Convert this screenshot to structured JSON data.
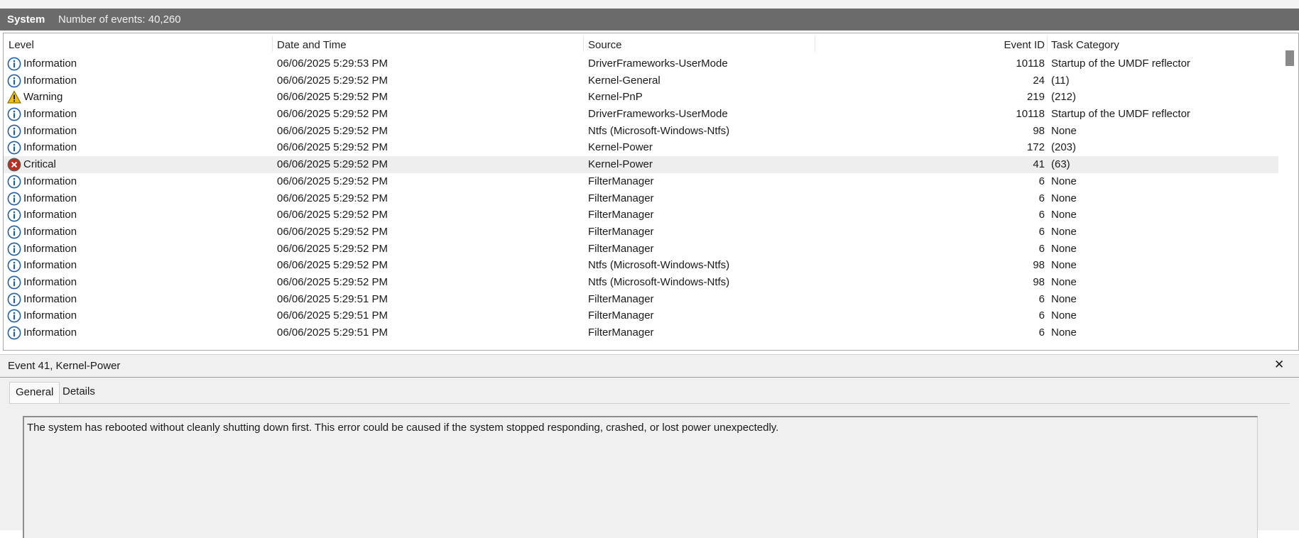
{
  "header": {
    "log_name": "System",
    "event_count": "Number of events: 40,260"
  },
  "columns": {
    "level": "Level",
    "date": "Date and Time",
    "source": "Source",
    "event_id": "Event ID",
    "task": "Task Category"
  },
  "rows": [
    {
      "level": "Information",
      "icon": "info-icon",
      "date": "06/06/2025 5:29:53 PM",
      "source": "DriverFrameworks-UserMode",
      "id": "10118",
      "task": "Startup of the UMDF reflector"
    },
    {
      "level": "Information",
      "icon": "info-icon",
      "date": "06/06/2025 5:29:52 PM",
      "source": "Kernel-General",
      "id": "24",
      "task": "(11)"
    },
    {
      "level": "Warning",
      "icon": "warning-icon",
      "date": "06/06/2025 5:29:52 PM",
      "source": "Kernel-PnP",
      "id": "219",
      "task": "(212)"
    },
    {
      "level": "Information",
      "icon": "info-icon",
      "date": "06/06/2025 5:29:52 PM",
      "source": "DriverFrameworks-UserMode",
      "id": "10118",
      "task": "Startup of the UMDF reflector"
    },
    {
      "level": "Information",
      "icon": "info-icon",
      "date": "06/06/2025 5:29:52 PM",
      "source": "Ntfs (Microsoft-Windows-Ntfs)",
      "id": "98",
      "task": "None"
    },
    {
      "level": "Information",
      "icon": "info-icon",
      "date": "06/06/2025 5:29:52 PM",
      "source": "Kernel-Power",
      "id": "172",
      "task": "(203)"
    },
    {
      "level": "Critical",
      "icon": "critical-icon",
      "date": "06/06/2025 5:29:52 PM",
      "source": "Kernel-Power",
      "id": "41",
      "task": "(63)",
      "selected": true
    },
    {
      "level": "Information",
      "icon": "info-icon",
      "date": "06/06/2025 5:29:52 PM",
      "source": "FilterManager",
      "id": "6",
      "task": "None"
    },
    {
      "level": "Information",
      "icon": "info-icon",
      "date": "06/06/2025 5:29:52 PM",
      "source": "FilterManager",
      "id": "6",
      "task": "None"
    },
    {
      "level": "Information",
      "icon": "info-icon",
      "date": "06/06/2025 5:29:52 PM",
      "source": "FilterManager",
      "id": "6",
      "task": "None"
    },
    {
      "level": "Information",
      "icon": "info-icon",
      "date": "06/06/2025 5:29:52 PM",
      "source": "FilterManager",
      "id": "6",
      "task": "None"
    },
    {
      "level": "Information",
      "icon": "info-icon",
      "date": "06/06/2025 5:29:52 PM",
      "source": "FilterManager",
      "id": "6",
      "task": "None"
    },
    {
      "level": "Information",
      "icon": "info-icon",
      "date": "06/06/2025 5:29:52 PM",
      "source": "Ntfs (Microsoft-Windows-Ntfs)",
      "id": "98",
      "task": "None"
    },
    {
      "level": "Information",
      "icon": "info-icon",
      "date": "06/06/2025 5:29:52 PM",
      "source": "Ntfs (Microsoft-Windows-Ntfs)",
      "id": "98",
      "task": "None"
    },
    {
      "level": "Information",
      "icon": "info-icon",
      "date": "06/06/2025 5:29:51 PM",
      "source": "FilterManager",
      "id": "6",
      "task": "None"
    },
    {
      "level": "Information",
      "icon": "info-icon",
      "date": "06/06/2025 5:29:51 PM",
      "source": "FilterManager",
      "id": "6",
      "task": "None"
    },
    {
      "level": "Information",
      "icon": "info-icon",
      "date": "06/06/2025 5:29:51 PM",
      "source": "FilterManager",
      "id": "6",
      "task": "None"
    }
  ],
  "detail": {
    "title": "Event 41, Kernel-Power",
    "close_glyph": "✕",
    "tabs": [
      "General",
      "Details"
    ],
    "active_tab": "General",
    "message": "The system has rebooted without cleanly shutting down first. This error could be caused if the system stopped responding, crashed, or lost power unexpectedly."
  },
  "colors": {
    "header_bg": "#6b6b6b",
    "selected_row": "#eeeeee",
    "info_blue": "#1f5fa8",
    "warning_yellow": "#f2c100",
    "critical_red": "#c42b1c"
  }
}
